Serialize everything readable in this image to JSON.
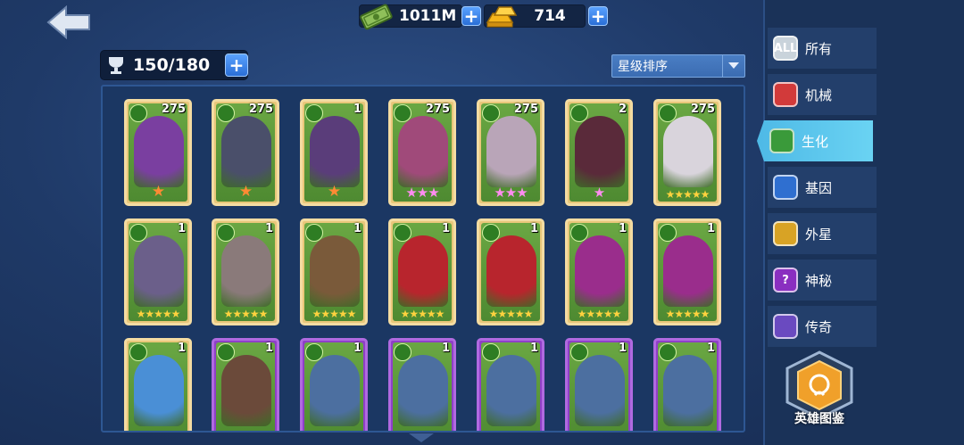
{
  "header": {
    "cash": {
      "value": "1011M",
      "icon": "cash-icon"
    },
    "gold": {
      "value": "714",
      "icon": "gold-bars-icon"
    },
    "back_icon": "back-arrow-icon"
  },
  "capacity": {
    "label": "150/180",
    "icon": "trophy-icon"
  },
  "sort": {
    "selected": "星级排序"
  },
  "cards": [
    {
      "level": "275",
      "stars": "★",
      "star_style": "orange",
      "frame": "gold",
      "hue": "#7a3fa0"
    },
    {
      "level": "275",
      "stars": "★",
      "star_style": "orange",
      "frame": "gold",
      "hue": "#4a4f6a"
    },
    {
      "level": "1",
      "stars": "★",
      "star_style": "orange",
      "frame": "gold",
      "hue": "#5a3d7a"
    },
    {
      "level": "275",
      "stars": "★★★",
      "star_style": "pink",
      "frame": "gold",
      "hue": "#a04a7a"
    },
    {
      "level": "275",
      "stars": "★★★",
      "star_style": "pink",
      "frame": "gold",
      "hue": "#b9a5b8"
    },
    {
      "level": "2",
      "stars": "★",
      "star_style": "pink",
      "frame": "gold",
      "hue": "#5a2a3a"
    },
    {
      "level": "275",
      "stars": "★★★★★",
      "star_style": "gold",
      "frame": "gold",
      "hue": "#d9d4dc"
    },
    {
      "level": "1",
      "stars": "★★★★★",
      "star_style": "gold",
      "frame": "gold",
      "hue": "#6b5f8a"
    },
    {
      "level": "1",
      "stars": "★★★★★",
      "star_style": "gold",
      "frame": "gold",
      "hue": "#8a7a7a"
    },
    {
      "level": "1",
      "stars": "★★★★★",
      "star_style": "gold",
      "frame": "gold",
      "hue": "#7a5a3a"
    },
    {
      "level": "1",
      "stars": "★★★★★",
      "star_style": "gold",
      "frame": "gold",
      "hue": "#b8252d"
    },
    {
      "level": "1",
      "stars": "★★★★★",
      "star_style": "gold",
      "frame": "gold",
      "hue": "#b8252d"
    },
    {
      "level": "1",
      "stars": "★★★★★",
      "star_style": "gold",
      "frame": "gold",
      "hue": "#9a2d8c"
    },
    {
      "level": "1",
      "stars": "★★★★★",
      "star_style": "gold",
      "frame": "gold",
      "hue": "#9a2d8c"
    },
    {
      "level": "1",
      "stars": "",
      "star_style": "gold",
      "frame": "gold",
      "hue": "#4a8fd6"
    },
    {
      "level": "1",
      "stars": "",
      "star_style": "gold",
      "frame": "purple",
      "hue": "#6b4a3a"
    },
    {
      "level": "1",
      "stars": "",
      "star_style": "gold",
      "frame": "purple",
      "hue": "#4c6fa0"
    },
    {
      "level": "1",
      "stars": "",
      "star_style": "gold",
      "frame": "purple",
      "hue": "#4c6fa0"
    },
    {
      "level": "1",
      "stars": "",
      "star_style": "gold",
      "frame": "purple",
      "hue": "#4c6fa0"
    },
    {
      "level": "1",
      "stars": "",
      "star_style": "gold",
      "frame": "purple",
      "hue": "#4c6fa0"
    },
    {
      "level": "1",
      "stars": "",
      "star_style": "gold",
      "frame": "purple",
      "hue": "#4c6fa0"
    }
  ],
  "sidebar": {
    "items": [
      {
        "label": "所有",
        "icon_text": "ALL",
        "icon": "all-icon",
        "color": "#c9d3db"
      },
      {
        "label": "机械",
        "icon_text": "",
        "icon": "mechanical-icon",
        "color": "#d23a3a"
      },
      {
        "label": "生化",
        "icon_text": "",
        "icon": "biochem-flask-icon",
        "color": "#3a9a3a"
      },
      {
        "label": "基因",
        "icon_text": "",
        "icon": "dna-icon",
        "color": "#2f6fd0"
      },
      {
        "label": "外星",
        "icon_text": "",
        "icon": "alien-icon",
        "color": "#d8a325"
      },
      {
        "label": "神秘",
        "icon_text": "?",
        "icon": "mystery-icon",
        "color": "#8a2fc0"
      },
      {
        "label": "传奇",
        "icon_text": "",
        "icon": "legend-icon",
        "color": "#6a4ac0"
      }
    ],
    "active": "生化",
    "codex": {
      "label": "英雄图鉴",
      "icon": "hero-codex-icon"
    }
  },
  "colors": {
    "accent": "#4eb9e6",
    "panel": "#1b3763"
  }
}
